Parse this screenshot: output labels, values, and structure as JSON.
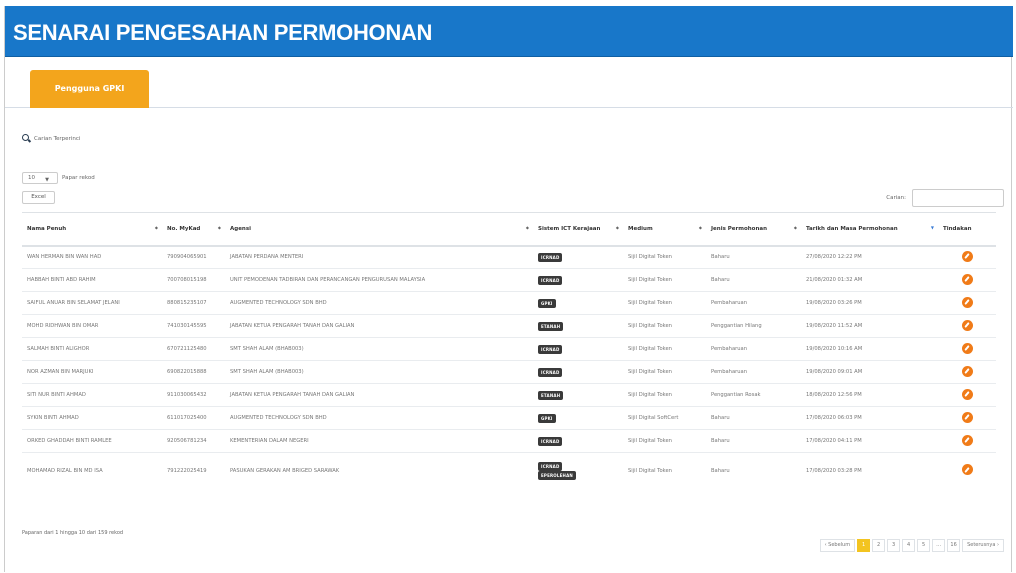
{
  "header": {
    "title": "SENARAI PENGESAHAN PERMOHONAN",
    "color": "#1877c9"
  },
  "tabs": [
    {
      "label": "Pengguna GPKI",
      "active": true
    }
  ],
  "search": {
    "advanced_label": "Carian Terperinci",
    "filter_label": "Carian:",
    "filter_value": ""
  },
  "length_menu": {
    "value": "10",
    "label": "Papar rekod"
  },
  "excel_label": "Excel",
  "table": {
    "columns": [
      "Nama Penuh",
      "No. MyKad",
      "Agensi",
      "Sistem ICT Kerajaan",
      "Medium",
      "Jenis Permohonan",
      "Tarikh dan Masa Permohonan",
      "Tindakan"
    ],
    "rows": [
      {
        "name": "WAN HERMAN BIN WAN HAD",
        "mykad": "790904065901",
        "agency": "JABATAN PERDANA MENTERI",
        "systems": [
          "ICRNAD"
        ],
        "medium": "Sijil Digital Token",
        "type": "Baharu",
        "datetime": "27/08/2020 12:22 PM"
      },
      {
        "name": "HABBAH BINTI ABD RAHIM",
        "mykad": "700708015198",
        "agency": "UNIT PEMODENAN TADBIRAN DAN PERANCANGAN PENGURUSAN MALAYSIA",
        "systems": [
          "ICRNAD"
        ],
        "medium": "Sijil Digital Token",
        "type": "Baharu",
        "datetime": "21/08/2020 01:32 AM"
      },
      {
        "name": "SAIFUL ANUAR BIN SELAMAT JELANI",
        "mykad": "880815235107",
        "agency": "AUGMENTED TECHNOLOGY SDN BHD",
        "systems": [
          "GPKI"
        ],
        "medium": "Sijil Digital Token",
        "type": "Pembaharuan",
        "datetime": "19/08/2020 03:26 PM"
      },
      {
        "name": "MOHD RIDHWAN BIN OMAR",
        "mykad": "741030145595",
        "agency": "JABATAN KETUA PENGARAH TANAH DAN GALIAN",
        "systems": [
          "ETANAH"
        ],
        "medium": "Sijil Digital Token",
        "type": "Penggantian Hilang",
        "datetime": "19/08/2020 11:52 AM"
      },
      {
        "name": "SALMAH BINTI ALIGHOR",
        "mykad": "670721125480",
        "agency": "SMT SHAH ALAM (BHAB003)",
        "systems": [
          "ICRNAD"
        ],
        "medium": "Sijil Digital Token",
        "type": "Pembaharuan",
        "datetime": "19/08/2020 10:16 AM"
      },
      {
        "name": "NOR AZMAN BIN MARJUKI",
        "mykad": "690822015888",
        "agency": "SMT SHAH ALAM (BHAB003)",
        "systems": [
          "ICRNAD"
        ],
        "medium": "Sijil Digital Token",
        "type": "Pembaharuan",
        "datetime": "19/08/2020 09:01 AM"
      },
      {
        "name": "SITI NUR BINTI AHMAD",
        "mykad": "911030065432",
        "agency": "JABATAN KETUA PENGARAH TANAH DAN GALIAN",
        "systems": [
          "ETANAH"
        ],
        "medium": "Sijil Digital Token",
        "type": "Penggantian Rosak",
        "datetime": "18/08/2020 12:56 PM"
      },
      {
        "name": "SYKIN BINTI AHMAD",
        "mykad": "611017025400",
        "agency": "AUGMENTED TECHNOLOGY SDN BHD",
        "systems": [
          "GPKI"
        ],
        "medium": "Sijil Digital SoftCert",
        "type": "Baharu",
        "datetime": "17/08/2020 06:03 PM"
      },
      {
        "name": "ORKED GHADDAH BINTI RAMLEE",
        "mykad": "920506781234",
        "agency": "KEMENTERIAN DALAM NEGERI",
        "systems": [
          "ICRNAD"
        ],
        "medium": "Sijil Digital Token",
        "type": "Baharu",
        "datetime": "17/08/2020 04:11 PM"
      },
      {
        "name": "MOHAMAD RIZAL BIN MD ISA",
        "mykad": "791222025419",
        "agency": "PASUKAN GERAKAN AM BRIGED SARAWAK",
        "systems": [
          "ICRNAD",
          "EPEROLEHAN"
        ],
        "medium": "Sijil Digital Token",
        "type": "Baharu",
        "datetime": "17/08/2020 03:28 PM"
      }
    ]
  },
  "pagination": {
    "info": "Paparan dari 1 hingga 10 dari 159 rekod",
    "prev": "‹ Sebelum",
    "pages": [
      "1",
      "2",
      "3",
      "4",
      "5",
      "…",
      "16"
    ],
    "next": "Seterusnya ›"
  }
}
